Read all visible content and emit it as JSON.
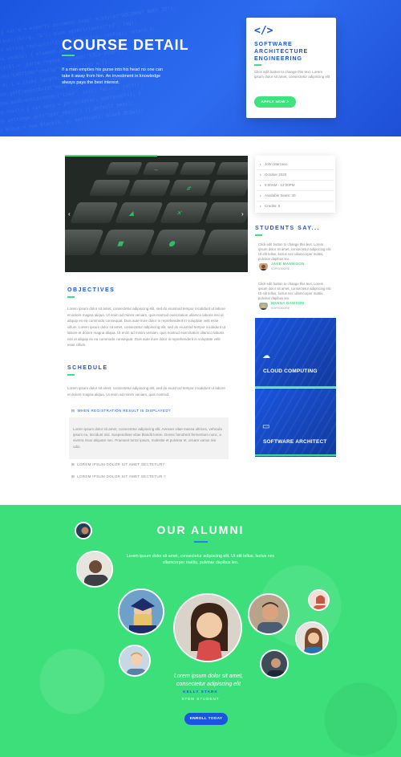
{
  "hero": {
    "title": "COURSE DETAIL",
    "text": "If a man empties his purse into his head no one can take it away from him. An investment in knowledge always pays the best interest."
  },
  "course_card": {
    "icon": "code-icon",
    "title": "SOFTWARE ARCHITECTURE ENGINEERING",
    "text": "Click edit button to change this text. Lorem ipsum dolor sit amet, consectetur adipiscing elit",
    "button_label": "APPLY NOW >"
  },
  "slider": {
    "prev_label": "‹",
    "next_label": "›"
  },
  "objectives": {
    "heading": "OBJECTIVES",
    "text": "Lorem ipsum dolor sit amet, consectetur adipiscing elit, sed do eiusmod tempor incididunt ut labore et dolore magna aliqua. Ut enim ad minim veniam, quis nostrud exercitation ullamco laboris nisi ut aliquip ex ea commodo consequat. Duis aute irure dolor in reprehenderit in voluptate velit esse cillum. Lorem ipsum dolor sit amet, consectetur adipiscing elit, sed do eiusmod tempor incididunt ut labore et dolore magna aliqua. Ut enim ad minim veniam, quis nostrud exercitation ullamco laboris nisi ut aliquip ex ea commodo consequat. Duis aute irure dolor in reprehenderit in voluptate velit esse cillum."
  },
  "schedule": {
    "heading": "SCHEDULE",
    "text": "Lorem ipsum dolor sit amet, consectetur adipiscing elit, sed do eiusmod tempor incididunt ut labore et dolore magna aliqua. Ut enim ad minim veniam, quis nostrud.",
    "accordion": [
      {
        "title": "WHEN REGISTRATION RESULT IS DISPLAYED?",
        "expanded": true,
        "content": "Lorem ipsum dolor sit amet, consectetur adipiscing elit. Aenean vitae massa ultrices, vehicula ipsum eu, tincidunt nisi. Suspendisse vitae blandit lorem. Donec hendrerit fermentum nunc, a viverra risus aliquam nec. Praesent tortor ipsum, molestie et pulvinar et, ornare varius nisi odio."
      },
      {
        "title": "LOREM IPSUM DOLOR SIT AMET SECTETUR?",
        "expanded": false
      },
      {
        "title": "LOREM IPSUM DOLOR SIT AMET SECTETUR ?",
        "expanded": false
      }
    ]
  },
  "info": {
    "items": [
      {
        "icon": "user-icon",
        "label": "John Marcano"
      },
      {
        "icon": "calendar-icon",
        "label": "October 2020"
      },
      {
        "icon": "clock-icon",
        "label": "8:00AM - 12:00PM"
      },
      {
        "icon": "seat-icon",
        "label": "Available Seats: 30"
      },
      {
        "icon": "credit-icon",
        "label": "Credits: 6"
      }
    ]
  },
  "testimonials": {
    "heading": "STUDENTS SAY...",
    "items": [
      {
        "text": "Click edit button to change this text. Lorem ipsum dolor sit amet, consectetur adipiscing elit. Ut elit tellus, luctus nec ullamcorper mattis, pulvinar dapibus leo.",
        "name": "JAKE MANNISON",
        "role": "SOPHOMORE"
      },
      {
        "text": "Click edit button to change this text. Lorem ipsum dolor sit amet, consectetur adipiscing elit. Ut elit tellus, luctus nec ullamcorper mattis, pulvinar dapibus leo.",
        "name": "HANNA DAWSON",
        "role": "SOPHOMORE"
      }
    ]
  },
  "categories": [
    {
      "icon": "cloud-icon",
      "label": "CLOUD COMPUTING"
    },
    {
      "icon": "monitor-icon",
      "label": "SOFTWARE ARCHITECT"
    }
  ],
  "alumni": {
    "title": "OUR ALUMNI",
    "subtitle": "Lorem ipsum dolor sit amet, consectetur adipiscing elit. Ut elit tellus, luctus nec ullamcorper mattis, pulvinar dapibus leo.",
    "quote": "Lorem ipsum dolor sit amet, consectetur adipiscing elit",
    "name": "KELLY STARK",
    "role": "STEM STUDENT",
    "button_label": "ENROLL TODAY"
  },
  "colors": {
    "primary_blue": "#1a55e0",
    "accent_green": "#3de37d",
    "alumni_green": "#3ddf7b"
  }
}
